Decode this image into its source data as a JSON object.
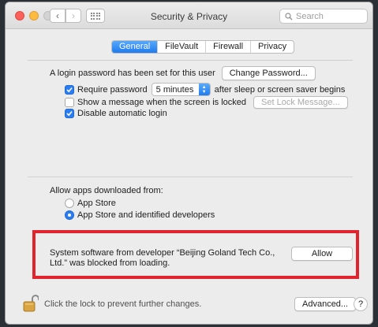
{
  "window": {
    "title": "Security & Privacy",
    "search_placeholder": "Search"
  },
  "tabs": [
    {
      "label": "General",
      "active": true
    },
    {
      "label": "FileVault",
      "active": false
    },
    {
      "label": "Firewall",
      "active": false
    },
    {
      "label": "Privacy",
      "active": false
    }
  ],
  "general": {
    "login_password_text": "A login password has been set for this user",
    "change_password_label": "Change Password...",
    "require_password": {
      "checked": true,
      "label": "Require password",
      "delay_value": "5 minutes",
      "suffix": "after sleep or screen saver begins"
    },
    "show_message": {
      "checked": false,
      "label": "Show a message when the screen is locked",
      "button_label": "Set Lock Message..."
    },
    "disable_auto_login": {
      "checked": true,
      "label": "Disable automatic login"
    }
  },
  "downloads": {
    "heading": "Allow apps downloaded from:",
    "options": [
      {
        "label": "App Store",
        "selected": false
      },
      {
        "label": "App Store and identified developers",
        "selected": true
      }
    ]
  },
  "blocked": {
    "message": "System software from developer “Beijing Goland Tech Co., Ltd.” was blocked from loading.",
    "allow_label": "Allow",
    "highlight_color": "#e1232e"
  },
  "footer": {
    "lock_text": "Click the lock to prevent further changes.",
    "advanced_label": "Advanced...",
    "help_label": "?"
  },
  "colors": {
    "accent": "#2a7cf0",
    "window_bg": "#ececec"
  }
}
